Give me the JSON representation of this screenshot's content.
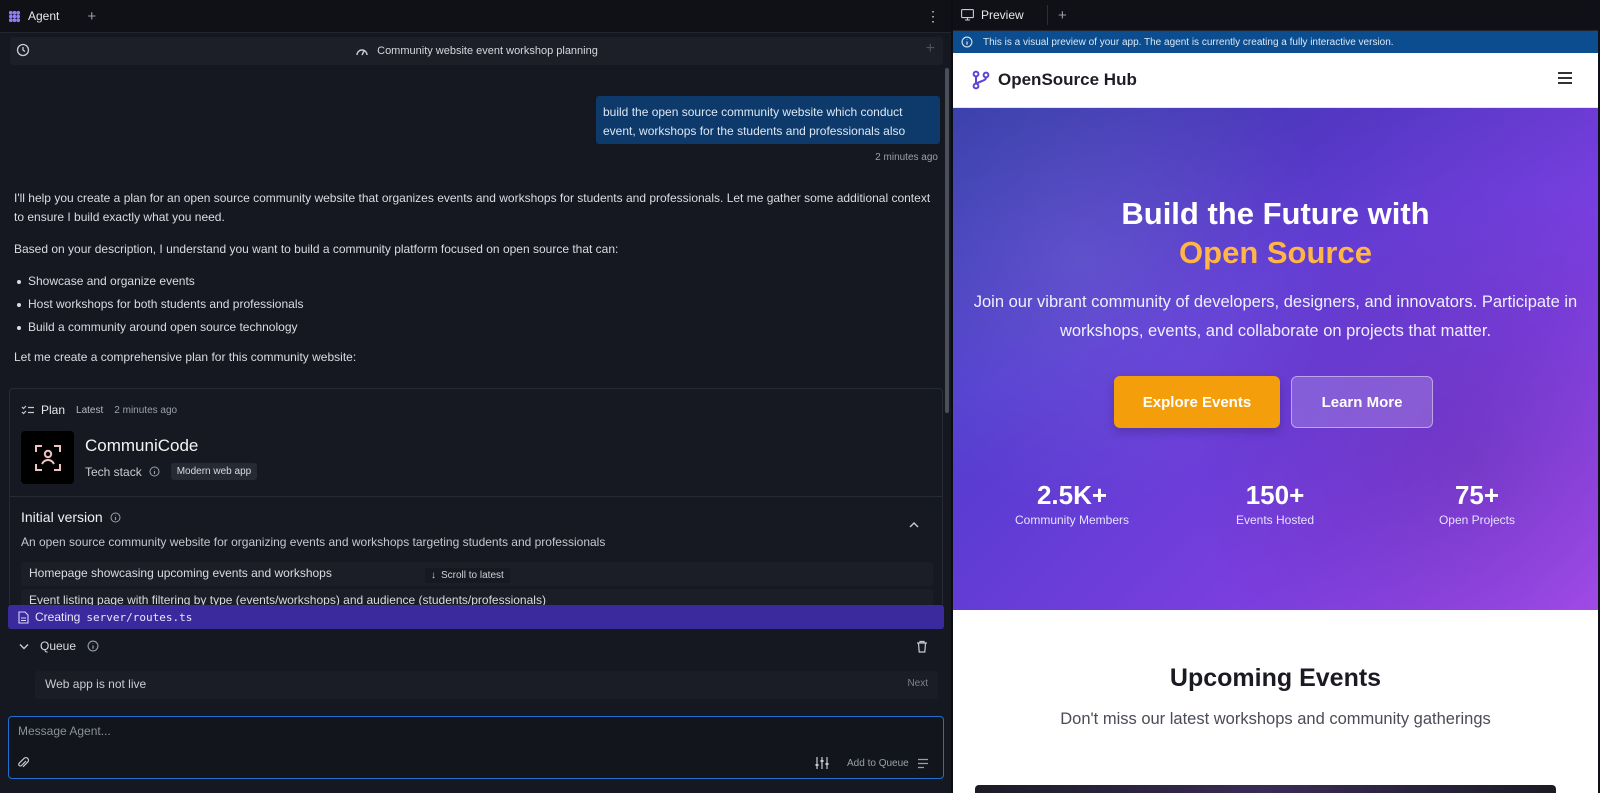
{
  "agent_panel": {
    "tab_label": "Agent",
    "conversation_title": "Community website event workshop planning",
    "user_message": "build the open source community website which conduct event, workshops for the students and professionals also",
    "user_message_time": "2 minutes ago",
    "agent_paragraph_1": "I'll help you create a plan for an open source community website that organizes events and workshops for students and professionals. Let me gather some additional context to ensure I build exactly what you need.",
    "agent_paragraph_2": "Based on your description, I understand you want to build a community platform focused on open source that can:",
    "agent_bullets": [
      "Showcase and organize events",
      "Host workshops for both students and professionals",
      "Build a community around open source technology"
    ],
    "agent_paragraph_3": "Let me create a comprehensive plan for this community website:",
    "plan": {
      "label": "Plan",
      "badge": "Latest",
      "time": "2 minutes ago",
      "app_name": "CommuniCode",
      "tech_stack_label": "Tech stack",
      "tech_stack_value": "Modern web app",
      "version_title": "Initial version",
      "version_description": "An open source community website for organizing events and workshops targeting students and professionals",
      "features": [
        "Homepage showcasing upcoming events and workshops",
        "Event listing page with filtering by type (events/workshops) and audience (students/professionals)"
      ]
    },
    "scroll_to_latest": "Scroll to latest",
    "creating_label": "Creating",
    "creating_file": "server/routes.ts",
    "queue": {
      "label": "Queue",
      "item": "Web app is not live",
      "item_action": "Next"
    },
    "composer": {
      "placeholder": "Message Agent...",
      "add_to_queue": "Add to Queue"
    }
  },
  "preview_panel": {
    "tab_label": "Preview",
    "info_text": "This is a visual preview of your app. The agent is currently creating a fully interactive version.",
    "site": {
      "brand": "OpenSource Hub",
      "hero_title": "Build the Future with",
      "hero_title_accent": "Open Source",
      "hero_subtitle": "Join our vibrant community of developers, designers, and innovators. Participate in workshops, events, and collaborate on projects that matter.",
      "primary_button": "Explore Events",
      "secondary_button": "Learn More",
      "stats": [
        {
          "value": "2.5K+",
          "label": "Community Members"
        },
        {
          "value": "150+",
          "label": "Events Hosted"
        },
        {
          "value": "75+",
          "label": "Open Projects"
        }
      ],
      "section_title": "Upcoming Events",
      "section_subtitle": "Don't miss our latest workshops and community gatherings"
    }
  },
  "colors": {
    "accent_blue": "#1e6fd1",
    "creating_bar": "#3b2a9e",
    "hero_accent": "#ffb547",
    "primary_button": "#f59e0b"
  }
}
